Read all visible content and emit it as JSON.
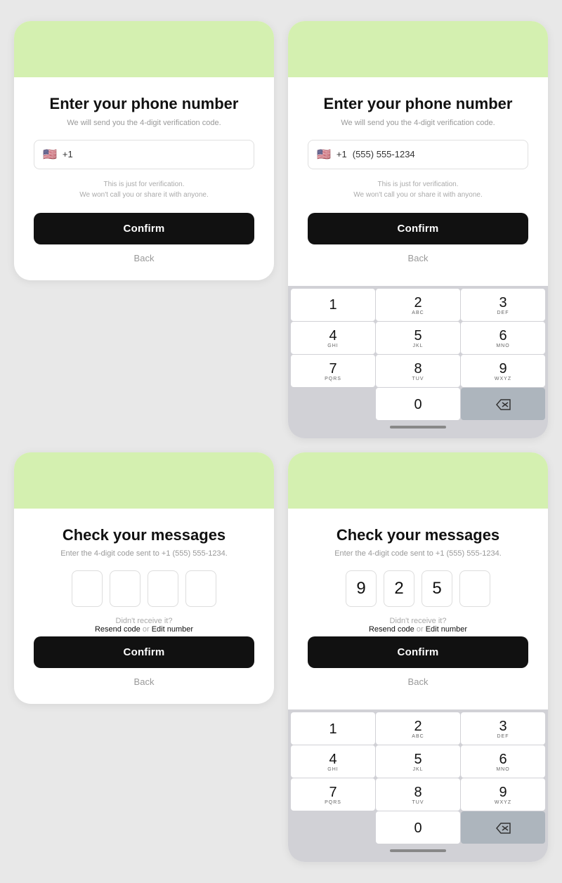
{
  "screens": {
    "phone_entry_simple": {
      "header_color": "#d4f0b0",
      "title": "Enter your phone number",
      "subtitle": "We will send you the 4-digit verification code.",
      "flag": "🇺🇸",
      "country_code": "+1",
      "phone_placeholder": "",
      "note_line1": "This is just for verification.",
      "note_line2": "We won't call you or share it with anyone.",
      "confirm_label": "Confirm",
      "back_label": "Back"
    },
    "phone_entry_keypad": {
      "header_color": "#d4f0b0",
      "title": "Enter your phone number",
      "subtitle": "We will send you the 4-digit verification code.",
      "flag": "🇺🇸",
      "country_code": "+1",
      "phone_value": "(555) 555-1234",
      "note_line1": "This is just for verification.",
      "note_line2": "We won't call you or share it with anyone.",
      "confirm_label": "Confirm",
      "back_label": "Back",
      "keypad": {
        "keys": [
          {
            "num": "1",
            "letters": ""
          },
          {
            "num": "2",
            "letters": "ABC"
          },
          {
            "num": "3",
            "letters": "DEF"
          },
          {
            "num": "4",
            "letters": "GHI"
          },
          {
            "num": "5",
            "letters": "JKL"
          },
          {
            "num": "6",
            "letters": "MNO"
          },
          {
            "num": "7",
            "letters": "PQRS"
          },
          {
            "num": "8",
            "letters": "TUV"
          },
          {
            "num": "9",
            "letters": "WXYZ"
          },
          {
            "num": "0",
            "letters": ""
          }
        ]
      }
    },
    "check_messages_simple": {
      "header_color": "#d4f0b0",
      "title": "Check your messages",
      "subtitle": "Enter the 4-digit code sent to +1 (555) 555-1234.",
      "code_digits": [
        "",
        "",
        "",
        ""
      ],
      "resend_label": "Didn't receive it?",
      "resend_code": "Resend code",
      "or_text": "or",
      "edit_label": "Edit number",
      "confirm_label": "Confirm",
      "back_label": "Back"
    },
    "check_messages_keypad": {
      "header_color": "#d4f0b0",
      "title": "Check your messages",
      "subtitle": "Enter the 4-digit code sent to +1 (555) 555-1234.",
      "code_digits": [
        "9",
        "2",
        "5",
        ""
      ],
      "resend_label": "Didn't receive it?",
      "resend_code": "Resend code",
      "or_text": "or",
      "edit_label": "Edit number",
      "confirm_label": "Confirm",
      "back_label": "Back",
      "keypad": {
        "keys": [
          {
            "num": "1",
            "letters": ""
          },
          {
            "num": "2",
            "letters": "ABC"
          },
          {
            "num": "3",
            "letters": "DEF"
          },
          {
            "num": "4",
            "letters": "GHI"
          },
          {
            "num": "5",
            "letters": "JKL"
          },
          {
            "num": "6",
            "letters": "MNO"
          },
          {
            "num": "7",
            "letters": "PQRS"
          },
          {
            "num": "8",
            "letters": "TUV"
          },
          {
            "num": "9",
            "letters": "WXYZ"
          },
          {
            "num": "0",
            "letters": ""
          }
        ]
      }
    }
  }
}
